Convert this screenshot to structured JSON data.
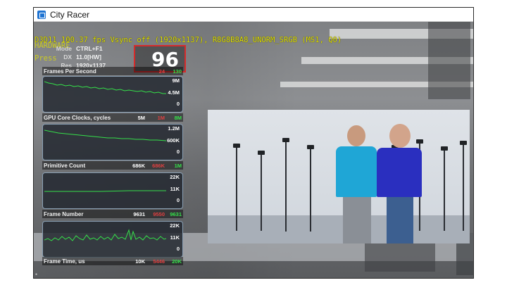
{
  "window": {
    "title": "City Racer"
  },
  "overlay": {
    "debug_line": "D3D11 100.37 fps Vsync off (1920x1137), R8G8B8A8_UNORM_SRGB (MS1, Q0)",
    "ghost_line_1": "HARDWARE",
    "ghost_line_2": "Press"
  },
  "info": {
    "mode_key": "Mode",
    "mode_val": "CTRL+F1",
    "dx_key": "DX",
    "dx_val": "11.0[HW]",
    "res_key": "Res",
    "res_val": "1920x1137"
  },
  "fps": {
    "value": "96",
    "label": "Frames Per Second",
    "min": "24",
    "max": "130"
  },
  "stats": [
    {
      "name": "GPU Core Clocks, cycles",
      "current": "5M",
      "min": "1M",
      "max": "8M",
      "axis": [
        "9M",
        "4.5M",
        "0"
      ]
    },
    {
      "name": "Primitive Count",
      "current": "686K",
      "min": "686K",
      "max": "1M",
      "axis": [
        "1.2M",
        "600K",
        "0"
      ]
    },
    {
      "name": "Frame Number",
      "current": "9631",
      "min": "9550",
      "max": "9631",
      "axis": [
        "22K",
        "11K",
        "0"
      ]
    },
    {
      "name": "Frame Time, us",
      "current": "10K",
      "min": "5446",
      "max": "20K",
      "axis": [
        "22K",
        "11K",
        "0"
      ]
    }
  ],
  "colors": {
    "fps_border": "#d62a2a",
    "graph_line": "#35e04a",
    "min_text": "#e04040",
    "max_text": "#35e04a",
    "debug_text": "#e2e200"
  },
  "icons": [
    "app-icon"
  ]
}
